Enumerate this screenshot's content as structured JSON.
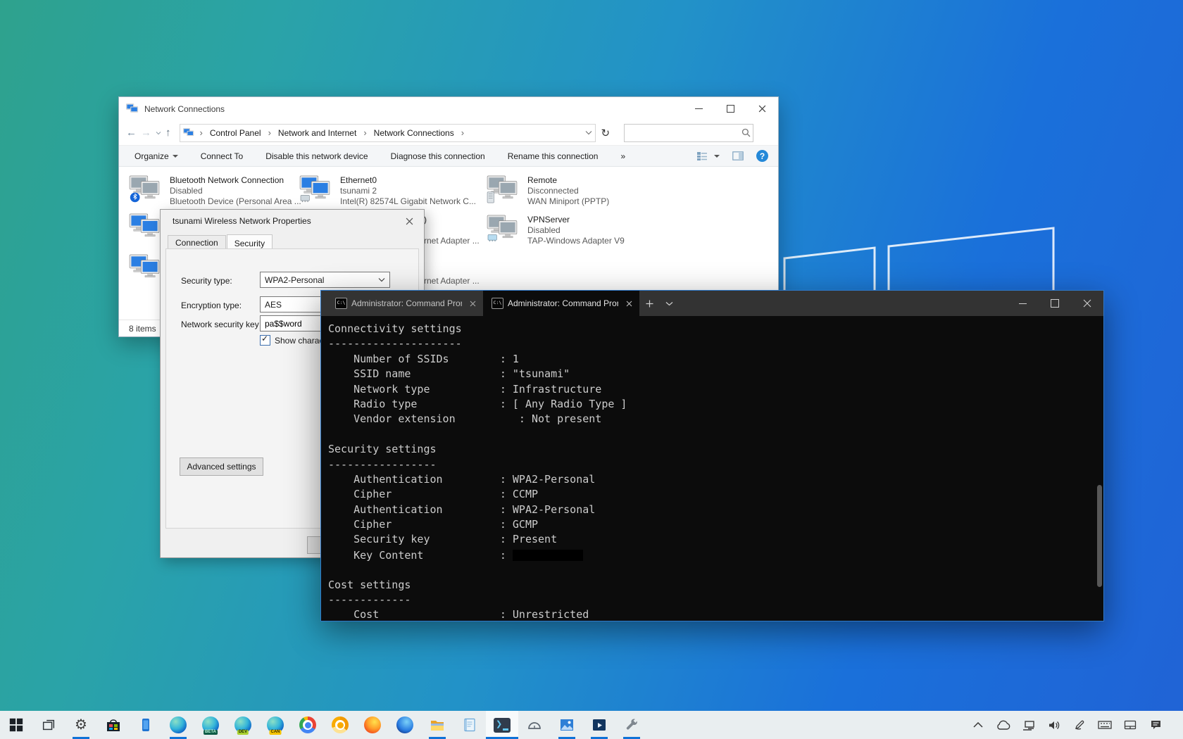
{
  "desktop": {
    "accent": "#0f72d7"
  },
  "explorer": {
    "title": "Network Connections",
    "breadcrumb": {
      "separator": "›",
      "items": [
        "Control Panel",
        "Network and Internet",
        "Network Connections"
      ]
    },
    "search_value": "",
    "toolbar": {
      "organize": "Organize",
      "connect": "Connect To",
      "disable": "Disable this network device",
      "diagnose": "Diagnose this connection",
      "rename": "Rename this connection",
      "more": "»"
    },
    "items": [
      {
        "name": "Bluetooth Network Connection",
        "status": "Disabled",
        "device": "Bluetooth Device (Personal Area ..."
      },
      {
        "name": "Ethernet0",
        "status": "tsunami 2",
        "device": "Intel(R) 82574L Gigabit Network C..."
      },
      {
        "name": "Remote",
        "status": "Disconnected",
        "device": "WAN Miniport (PPTP)"
      },
      {
        "name": "VPNServer",
        "status": "Disabled",
        "device": "TAP-Windows Adapter V9"
      }
    ],
    "hidden_fragments": {
      "row2_title_tail": ")",
      "row2_device": "rnet Adapter ...",
      "row3_device": "rnet Adapter ..."
    },
    "status": "8 items"
  },
  "dialog": {
    "title": "tsunami Wireless Network Properties",
    "tabs": [
      "Connection",
      "Security"
    ],
    "security_type_label": "Security type:",
    "security_type_value": "WPA2-Personal",
    "encryption_type_label": "Encryption type:",
    "encryption_type_value": "AES",
    "key_label": "Network security key",
    "key_value": "pa$$word",
    "show_characters_label": "Show characters",
    "advanced_button": "Advanced settings"
  },
  "terminal": {
    "tabs": [
      "Administrator: Command Prompt",
      "Administrator: Command Prompt"
    ],
    "lines": [
      "Connectivity settings",
      "---------------------",
      "    Number of SSIDs        : 1",
      "    SSID name              : \"tsunami\"",
      "    Network type           : Infrastructure",
      "    Radio type             : [ Any Radio Type ]",
      "    Vendor extension          : Not present",
      "",
      "Security settings",
      "-----------------",
      "    Authentication         : WPA2-Personal",
      "    Cipher                 : CCMP",
      "    Authentication         : WPA2-Personal",
      "    Cipher                 : GCMP",
      "    Security key           : Present",
      "    Key Content            : ",
      "",
      "Cost settings",
      "-------------",
      "    Cost                   : Unrestricted"
    ]
  },
  "taskbar": {
    "apps": [
      {
        "name": "start"
      },
      {
        "name": "task-view"
      },
      {
        "name": "settings",
        "open": true
      },
      {
        "name": "microsoft-store"
      },
      {
        "name": "your-phone"
      },
      {
        "name": "edge",
        "open": true
      },
      {
        "name": "edge-beta",
        "badge": "BETA"
      },
      {
        "name": "edge-dev",
        "badge": "DEV"
      },
      {
        "name": "edge-canary",
        "badge": "CAN"
      },
      {
        "name": "chrome"
      },
      {
        "name": "chrome-canary"
      },
      {
        "name": "firefox"
      },
      {
        "name": "firefox-nightly"
      },
      {
        "name": "file-explorer",
        "open": true
      },
      {
        "name": "notepad"
      },
      {
        "name": "windows-terminal",
        "active": true
      },
      {
        "name": "protractor"
      },
      {
        "name": "photos",
        "open": true
      },
      {
        "name": "movies-tv",
        "open": true
      },
      {
        "name": "dev-tool",
        "open": true
      }
    ],
    "tray": [
      "hidden-icons-chevron",
      "onedrive",
      "network",
      "volume",
      "windows-ink-pen",
      "touch-keyboard",
      "touchpad",
      "action-center"
    ]
  }
}
